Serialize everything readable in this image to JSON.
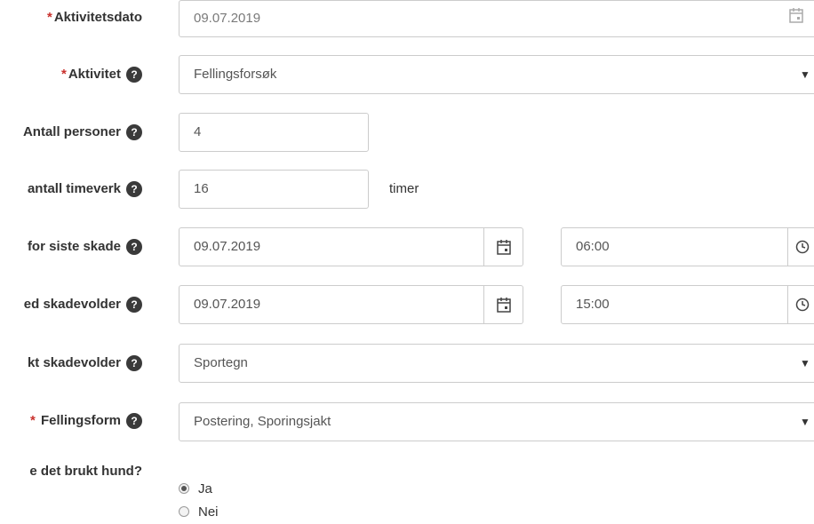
{
  "form": {
    "activity_date": {
      "label": "Aktivitetsdato",
      "required": "*",
      "value": "09.07.2019"
    },
    "activity": {
      "label": "Aktivitet",
      "required": "*",
      "value": "Fellingsforsøk"
    },
    "persons": {
      "label": "Antall personer",
      "value": "4"
    },
    "hours": {
      "label": "antall timeverk",
      "value": "16",
      "unit": "timer"
    },
    "last_damage": {
      "label": "for siste skade",
      "date": "09.07.2019",
      "time": "06:00"
    },
    "predator_observed": {
      "label": "ed skadevolder",
      "date": "09.07.2019",
      "time": "15:00"
    },
    "predator_evidence": {
      "label": "kt skadevolder",
      "value": "Sportegn"
    },
    "kill_form": {
      "label": "Fellingsform",
      "required": "*",
      "value": "Postering, Sporingsjakt"
    },
    "dog_used": {
      "label": "e det brukt hund?",
      "options": [
        {
          "label": "Ja",
          "checked": true
        },
        {
          "label": "Nei",
          "checked": false
        }
      ]
    }
  },
  "icons": {
    "help": "?",
    "caret": "▼"
  },
  "colors": {
    "required": "#c9302c",
    "border": "#cccccc",
    "text": "#333333"
  }
}
